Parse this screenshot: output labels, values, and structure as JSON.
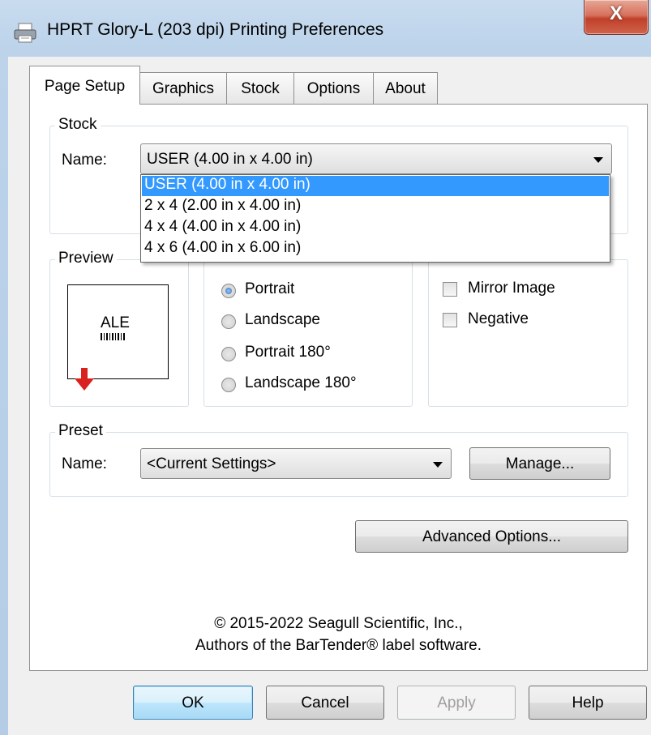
{
  "window": {
    "title": "HPRT Glory-L (203 dpi) Printing Preferences",
    "close_glyph": "X"
  },
  "tabs": [
    "Page Setup",
    "Graphics",
    "Stock",
    "Options",
    "About"
  ],
  "stock": {
    "group_label": "Stock",
    "name_label": "Name:",
    "selected": "USER (4.00 in x 4.00 in)",
    "options": [
      "USER (4.00 in x 4.00 in)",
      "2 x 4 (2.00 in x 4.00 in)",
      "4 x 4 (4.00 in x 4.00 in)",
      "4 x 6 (4.00 in x 6.00 in)"
    ]
  },
  "preview": {
    "group_label": "Preview",
    "label_text": "ALE",
    "arrow_color": "#d9221f"
  },
  "orientation": {
    "options": [
      "Portrait",
      "Landscape",
      "Portrait 180°",
      "Landscape 180°"
    ],
    "selected": "Portrait"
  },
  "effects": {
    "options": [
      "Mirror Image",
      "Negative"
    ],
    "checked": []
  },
  "preset": {
    "group_label": "Preset",
    "name_label": "Name:",
    "selected": "<Current Settings>",
    "manage_label": "Manage..."
  },
  "advanced_label": "Advanced Options...",
  "copyright": {
    "line1": "© 2015-2022 Seagull Scientific, Inc.,",
    "line2": "Authors of the BarTender® label software."
  },
  "buttons": {
    "ok": "OK",
    "cancel": "Cancel",
    "apply": "Apply",
    "help": "Help"
  },
  "colors": {
    "selection": "#3399ff",
    "ok_border": "#3c7fb1"
  }
}
